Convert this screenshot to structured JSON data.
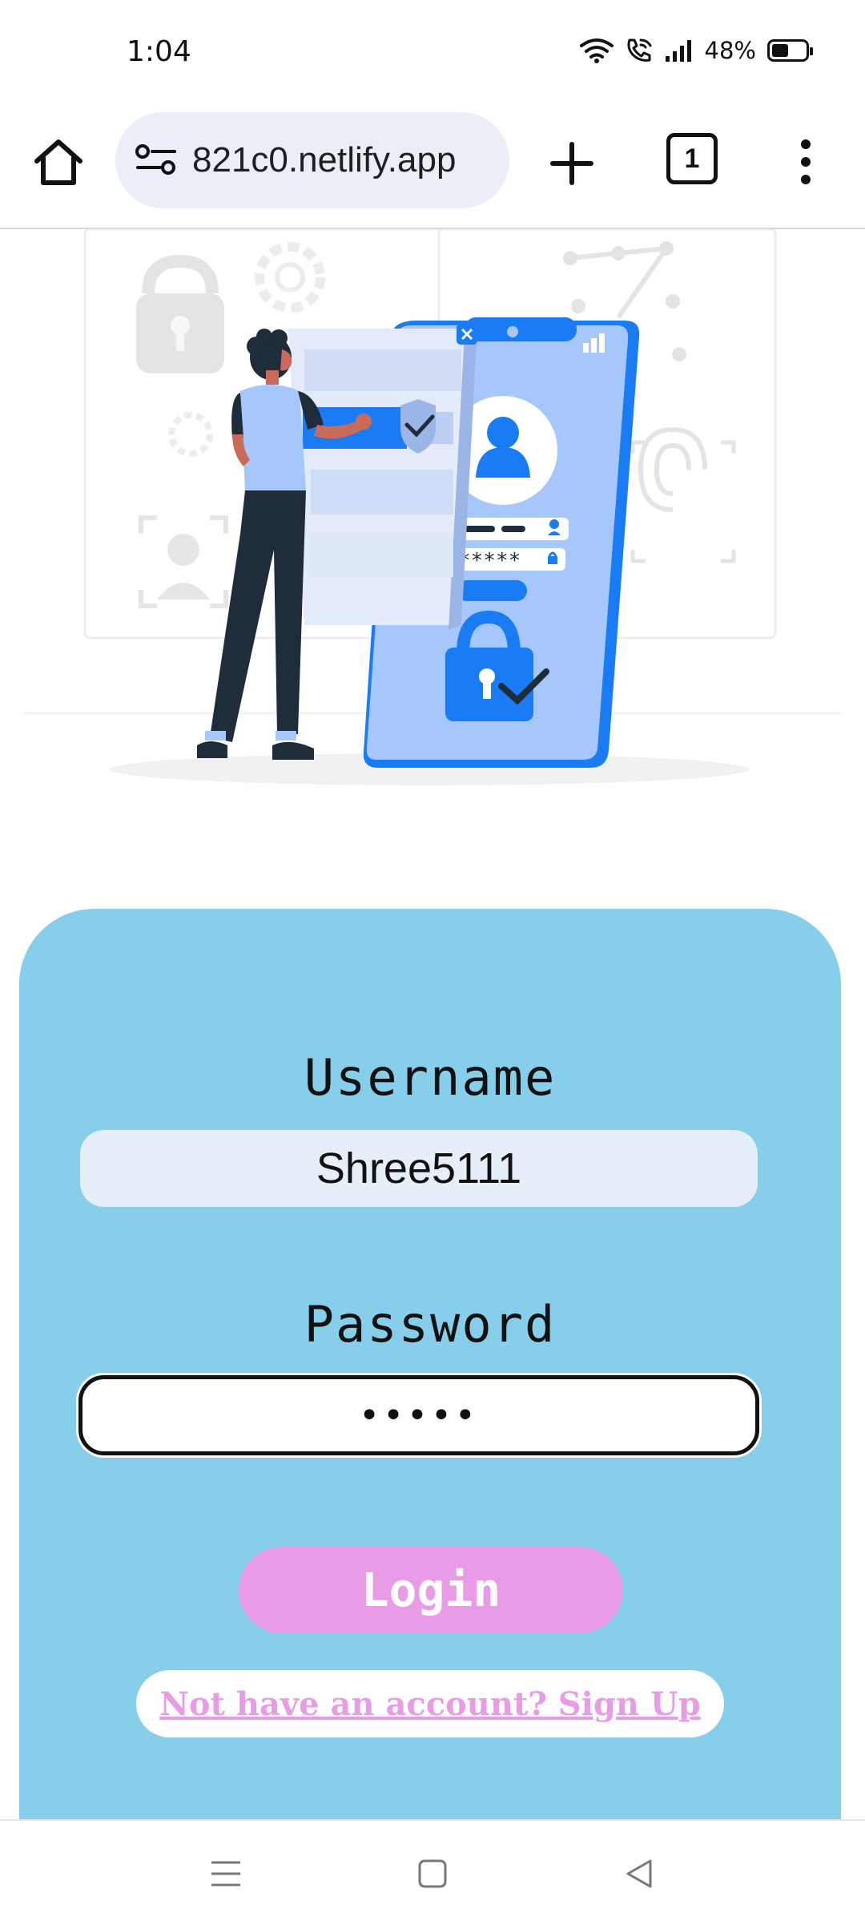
{
  "status_bar": {
    "time": "1:04",
    "battery_percent": "48%",
    "icons": [
      "wifi-icon",
      "wifi-call-icon",
      "signal-icon",
      "battery-icon"
    ]
  },
  "browser": {
    "url": "821c0.netlify.app",
    "tab_count": "1",
    "icons": [
      "home-icon",
      "site-settings-icon",
      "new-tab-icon",
      "tab-switcher-icon",
      "overflow-menu-icon"
    ]
  },
  "login_form": {
    "username_label": "Username",
    "username_value": "Shree5111",
    "password_label": "Password",
    "password_value": "•••••",
    "login_button": "Login",
    "signup_link": "Not have an account? Sign Up"
  },
  "colors": {
    "card_background": "#87ceeb",
    "accent_pink": "#e89ce6",
    "illustration_blue": "#1a7cf5"
  },
  "nav_bar": {
    "icons": [
      "recent-apps-icon",
      "home-nav-icon",
      "back-icon"
    ]
  }
}
